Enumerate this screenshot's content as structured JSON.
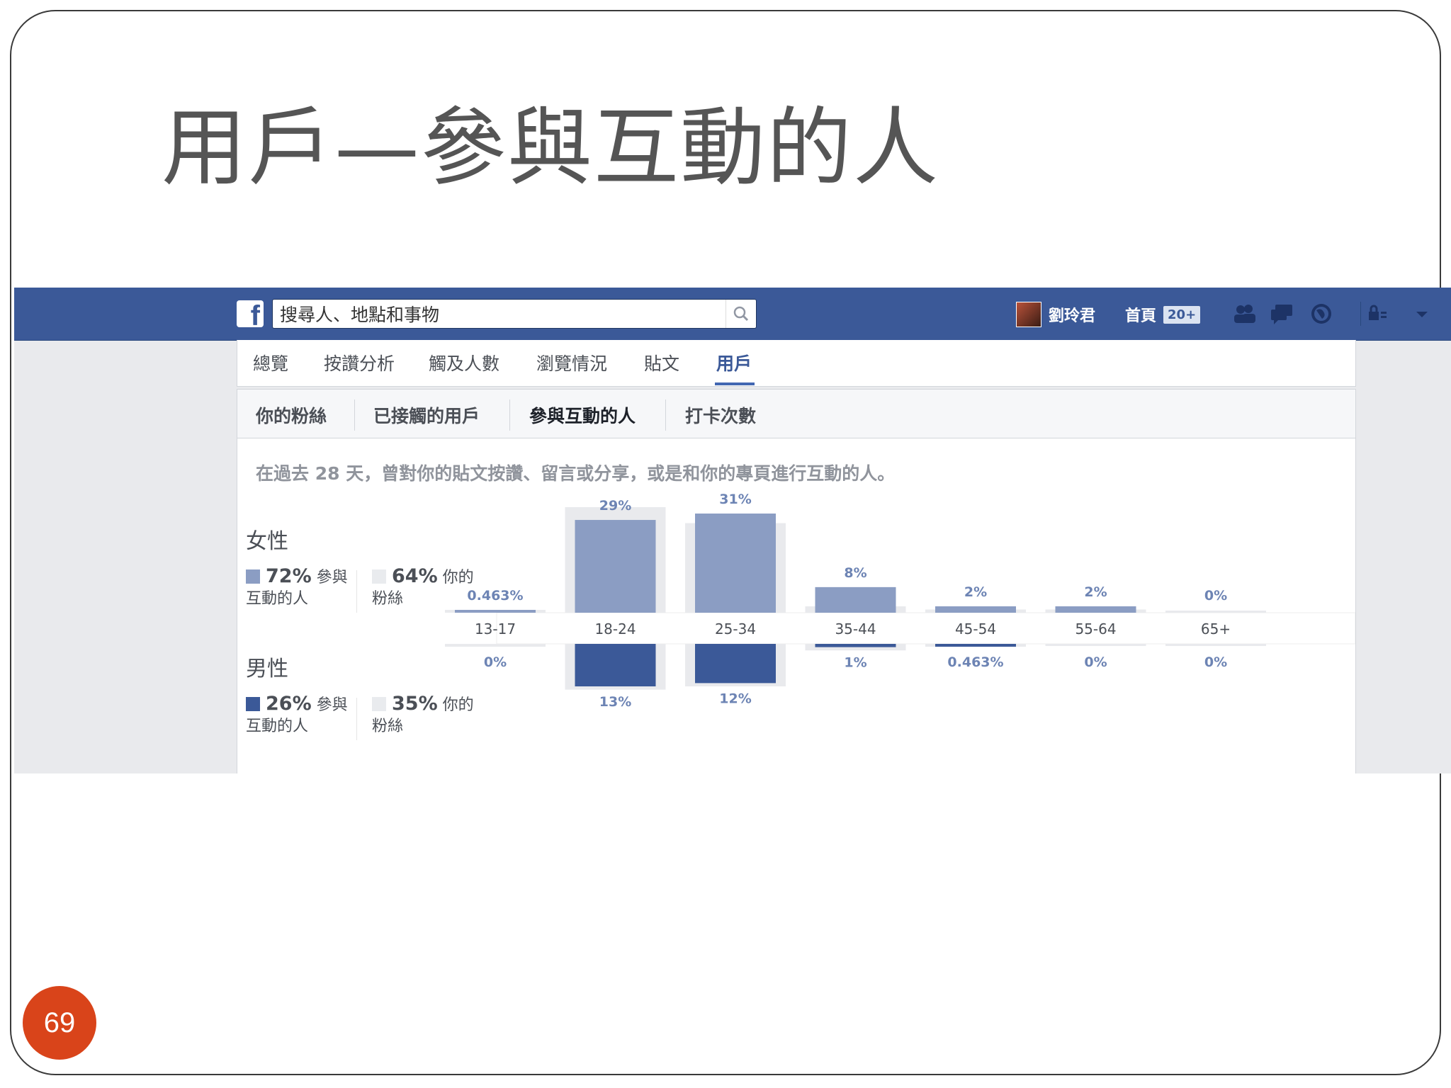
{
  "slide": {
    "title": "用戶—參與互動的人",
    "page_number": "69"
  },
  "facebook": {
    "search_placeholder": "搜尋人、地點和事物",
    "user_name": "劉玲君",
    "home_label": "首頁",
    "home_badge": "20+",
    "colors": {
      "brand": "#3b5998",
      "women": "#8b9dc3",
      "men": "#3b5998"
    }
  },
  "tabs": [
    "總覽",
    "按讚分析",
    "觸及人數",
    "瀏覽情況",
    "貼文",
    "用戶"
  ],
  "active_tab": "用戶",
  "subtabs": [
    "你的粉絲",
    "已接觸的用戶",
    "參與互動的人",
    "打卡次數"
  ],
  "active_subtab": "參與互動的人",
  "description": "在過去 28 天，曾對你的貼文按讚、留言或分享，或是和你的專頁進行互動的人。",
  "women": {
    "heading": "女性",
    "engaged_pct": "72%",
    "engaged_label_1": "參與",
    "engaged_label_2": "互動的人",
    "fans_pct": "64%",
    "fans_label_1": "你的",
    "fans_label_2": "粉絲"
  },
  "men": {
    "heading": "男性",
    "engaged_pct": "26%",
    "engaged_label_1": "參與",
    "engaged_label_2": "互動的人",
    "fans_pct": "35%",
    "fans_label_1": "你的",
    "fans_label_2": "粉絲"
  },
  "chart_data": {
    "type": "bar",
    "categories": [
      "13-17",
      "18-24",
      "25-34",
      "35-44",
      "45-54",
      "55-64",
      "65+"
    ],
    "series": [
      {
        "name": "女性",
        "values": [
          0.463,
          29,
          31,
          8,
          2,
          2,
          0
        ],
        "labels": [
          "0.463%",
          "29%",
          "31%",
          "8%",
          "2%",
          "2%",
          "0%"
        ]
      },
      {
        "name": "男性",
        "values": [
          0,
          13,
          12,
          1,
          0.463,
          0,
          0
        ],
        "labels": [
          "0%",
          "13%",
          "12%",
          "1%",
          "0.463%",
          "0%",
          "0%"
        ]
      }
    ],
    "fans_series": [
      {
        "name": "你的粉絲 (女性)",
        "values": [
          0.3,
          33,
          28,
          2,
          1,
          1,
          0
        ]
      },
      {
        "name": "你的粉絲 (男性)",
        "values": [
          0.2,
          14,
          13,
          2,
          0.5,
          0,
          0
        ]
      }
    ],
    "layout": "mirrored: women above axis, men below"
  }
}
